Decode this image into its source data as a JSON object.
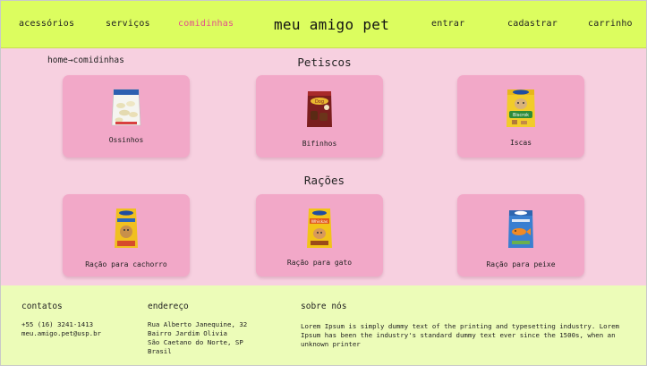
{
  "header": {
    "nav_left": [
      "acessórios",
      "serviços",
      "comidinhas"
    ],
    "brand": "meu amigo pet",
    "nav_right": [
      "entrar",
      "cadastrar",
      "carrinho"
    ],
    "active_color": "#e3508a",
    "background": "#dcfd5f"
  },
  "breadcrumb": "home→comidinhas",
  "sections": [
    {
      "title": "Petiscos",
      "items": [
        {
          "label": "Ossinhos",
          "icon": "bone-treats-bag-icon"
        },
        {
          "label": "Bifinhos",
          "icon": "meat-strips-bag-icon"
        },
        {
          "label": "Iscas",
          "icon": "pedigree-biscrok-bag-icon"
        }
      ]
    },
    {
      "title": "Rações",
      "items": [
        {
          "label": "Ração para cachorro",
          "icon": "dog-food-bag-icon"
        },
        {
          "label": "Ração para gato",
          "icon": "cat-food-bag-icon"
        },
        {
          "label": "Ração para peixe",
          "icon": "fish-food-bag-icon"
        }
      ]
    }
  ],
  "footer": {
    "contacts_title": "contatos",
    "phone": "+55 (16) 3241-1413",
    "email": "meu.amigo.pet@usp.br",
    "address_title": "endereço",
    "address": [
      "Rua Alberto Janequine, 32",
      "Bairro Jardim Olivia",
      "São Caetano do Norte, SP",
      "Brasil"
    ],
    "about_title": "sobre nós",
    "about_text": "Lorem Ipsum is simply dummy text of the printing and typesetting industry. Lorem Ipsum has been the industry's standard dummy text ever since the 1500s, when an unknown printer"
  },
  "colors": {
    "page": "#f7d0e0",
    "card": "#f2a8c8",
    "footer": "#ecfcb8"
  }
}
